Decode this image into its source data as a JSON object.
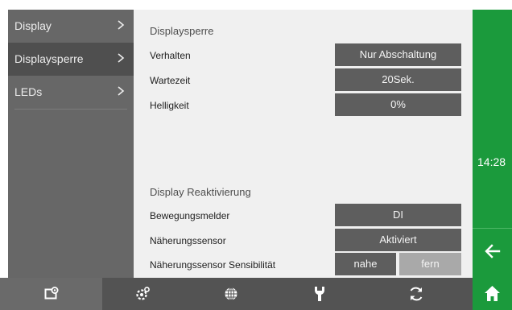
{
  "sidebar": {
    "items": [
      {
        "label": "Display"
      },
      {
        "label": "Displaysperre"
      },
      {
        "label": "LEDs"
      }
    ]
  },
  "main": {
    "section1_title": "Displaysperre",
    "rows1": [
      {
        "label": "Verhalten",
        "value": "Nur Abschaltung"
      },
      {
        "label": "Wartezeit",
        "value": "20Sek."
      },
      {
        "label": "Helligkeit",
        "value": "0%"
      }
    ],
    "section2_title": "Display Reaktivierung",
    "rows2": [
      {
        "label": "Bewegungsmelder",
        "value": "DI"
      },
      {
        "label": "Näherungssensor",
        "value": "Aktiviert"
      }
    ],
    "sensitivity": {
      "label": "Näherungssensor Sensibilität",
      "option_near": "nahe",
      "option_far": "fern"
    }
  },
  "status": {
    "time": "14:28"
  },
  "icons": {
    "toolbar": [
      "screen-settings-icon",
      "gear-icon",
      "globe-icon",
      "wrench-icon",
      "refresh-icon"
    ],
    "right": [
      "back-arrow-icon",
      "home-icon"
    ]
  },
  "colors": {
    "accent_green": "#1b9a3c",
    "sidebar": "#676767",
    "button": "#5e5e5e",
    "toolbar": "#535353"
  }
}
